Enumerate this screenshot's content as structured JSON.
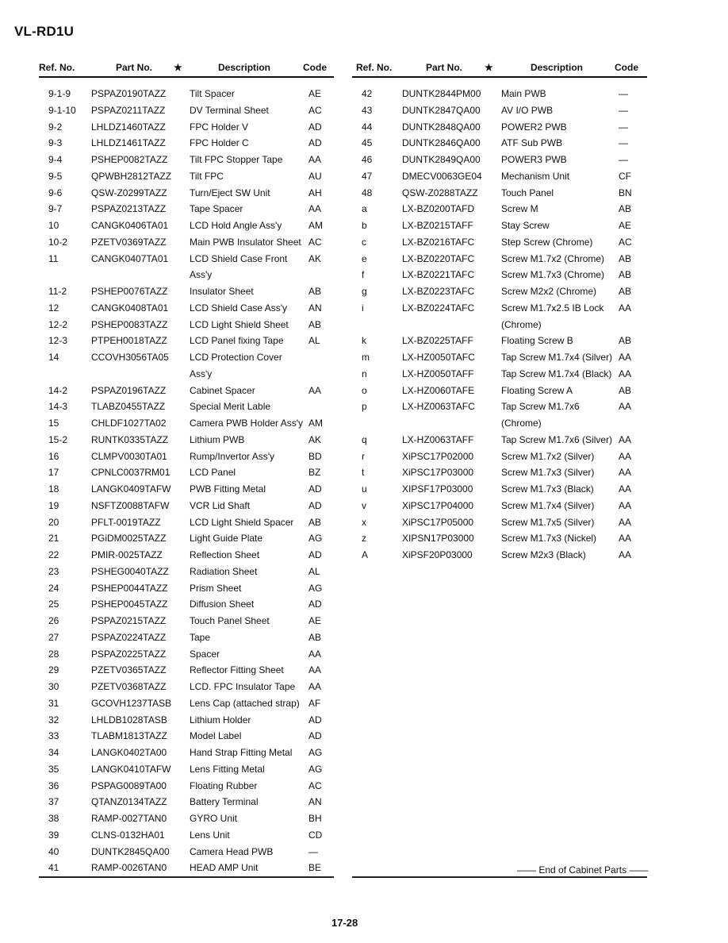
{
  "model": "VL-RD1U",
  "headers": {
    "ref": "Ref. No.",
    "part": "Part No.",
    "star": "★",
    "desc": "Description",
    "code": "Code"
  },
  "left_rows": [
    {
      "ref": "9-1-9",
      "part": "PSPAZ0190TAZZ",
      "desc": "Tilt Spacer",
      "code": "AE"
    },
    {
      "ref": "9-1-10",
      "part": "PSPAZ0211TAZZ",
      "desc": "DV Terminal Sheet",
      "code": "AC"
    },
    {
      "ref": "9-2",
      "part": "LHLDZ1460TAZZ",
      "desc": "FPC Holder V",
      "code": "AD"
    },
    {
      "ref": "9-3",
      "part": "LHLDZ1461TAZZ",
      "desc": "FPC Holder C",
      "code": "AD"
    },
    {
      "ref": "9-4",
      "part": "PSHEP0082TAZZ",
      "desc": "Tilt FPC Stopper Tape",
      "code": "AA"
    },
    {
      "ref": "9-5",
      "part": "QPWBH2812TAZZ",
      "desc": "Tilt FPC",
      "code": "AU"
    },
    {
      "ref": "9-6",
      "part": "QSW-Z0299TAZZ",
      "desc": "Turn/Eject SW Unit",
      "code": "AH"
    },
    {
      "ref": "9-7",
      "part": "PSPAZ0213TAZZ",
      "desc": "Tape Spacer",
      "code": "AA"
    },
    {
      "ref": "10",
      "part": "CANGK0406TA01",
      "desc": "LCD Hold Angle Ass'y",
      "code": "AM"
    },
    {
      "ref": "10-2",
      "part": "PZETV0369TAZZ",
      "desc": "Main PWB Insulator Sheet",
      "code": "AC"
    },
    {
      "ref": "11",
      "part": "CANGK0407TA01",
      "desc": "LCD Shield Case Front",
      "code": "AK"
    },
    {
      "ref": "",
      "part": "",
      "desc": "Ass'y",
      "code": ""
    },
    {
      "ref": "11-2",
      "part": "PSHEP0076TAZZ",
      "desc": "Insulator Sheet",
      "code": "AB"
    },
    {
      "ref": "12",
      "part": "CANGK0408TA01",
      "desc": "LCD Shield Case Ass'y",
      "code": "AN"
    },
    {
      "ref": "12-2",
      "part": "PSHEP0083TAZZ",
      "desc": "LCD Light Shield Sheet",
      "code": "AB"
    },
    {
      "ref": "12-3",
      "part": "PTPEH0018TAZZ",
      "desc": "LCD Panel fixing Tape",
      "code": "AL"
    },
    {
      "ref": "14",
      "part": "CCOVH3056TA05",
      "desc": "LCD Protection Cover",
      "code": ""
    },
    {
      "ref": "",
      "part": "",
      "desc": "Ass'y",
      "code": ""
    },
    {
      "ref": "14-2",
      "part": "PSPAZ0196TAZZ",
      "desc": "Cabinet Spacer",
      "code": "AA"
    },
    {
      "ref": "14-3",
      "part": "TLABZ0455TAZZ",
      "desc": "Special Merit Lable",
      "code": ""
    },
    {
      "ref": "15",
      "part": "CHLDF1027TA02",
      "desc": "Camera PWB Holder Ass'y",
      "code": "AM"
    },
    {
      "ref": "15-2",
      "part": "RUNTK0335TAZZ",
      "desc": "Lithium PWB",
      "code": "AK"
    },
    {
      "ref": "16",
      "part": "CLMPV0030TA01",
      "desc": "Rump/Invertor Ass'y",
      "code": "BD"
    },
    {
      "ref": "17",
      "part": "CPNLC0037RM01",
      "desc": "LCD Panel",
      "code": "BZ"
    },
    {
      "ref": "18",
      "part": "LANGK0409TAFW",
      "desc": "PWB Fitting Metal",
      "code": "AD"
    },
    {
      "ref": "19",
      "part": "NSFTZ0088TAFW",
      "desc": "VCR Lid Shaft",
      "code": "AD"
    },
    {
      "ref": "20",
      "part": "PFLT-0019TAZZ",
      "desc": "LCD Light Shield Spacer",
      "code": "AB"
    },
    {
      "ref": "21",
      "part": "PGiDM0025TAZZ",
      "desc": "Light Guide Plate",
      "code": "AG"
    },
    {
      "ref": "22",
      "part": "PMIR-0025TAZZ",
      "desc": "Reflection Sheet",
      "code": "AD"
    },
    {
      "ref": "23",
      "part": "PSHEG0040TAZZ",
      "desc": "Radiation Sheet",
      "code": "AL"
    },
    {
      "ref": "24",
      "part": "PSHEP0044TAZZ",
      "desc": "Prism Sheet",
      "code": "AG"
    },
    {
      "ref": "25",
      "part": "PSHEP0045TAZZ",
      "desc": "Diffusion Sheet",
      "code": "AD"
    },
    {
      "ref": "26",
      "part": "PSPAZ0215TAZZ",
      "desc": "Touch Panel Sheet",
      "code": "AE"
    },
    {
      "ref": "27",
      "part": "PSPAZ0224TAZZ",
      "desc": "Tape",
      "code": "AB"
    },
    {
      "ref": "28",
      "part": "PSPAZ0225TAZZ",
      "desc": "Spacer",
      "code": "AA"
    },
    {
      "ref": "29",
      "part": "PZETV0365TAZZ",
      "desc": "Reflector Fitting Sheet",
      "code": "AA"
    },
    {
      "ref": "30",
      "part": "PZETV0368TAZZ",
      "desc": "LCD. FPC Insulator Tape",
      "code": "AA"
    },
    {
      "ref": "31",
      "part": "GCOVH1237TASB",
      "desc": "Lens Cap (attached strap)",
      "code": "AF"
    },
    {
      "ref": "32",
      "part": "LHLDB1028TASB",
      "desc": "Lithium Holder",
      "code": "AD"
    },
    {
      "ref": "33",
      "part": "TLABM1813TAZZ",
      "desc": "Model Label",
      "code": "AD"
    },
    {
      "ref": "34",
      "part": "LANGK0402TA00",
      "desc": "Hand Strap Fitting Metal",
      "code": "AG"
    },
    {
      "ref": "35",
      "part": "LANGK0410TAFW",
      "desc": "Lens Fitting Metal",
      "code": "AG"
    },
    {
      "ref": "36",
      "part": "PSPAG0089TA00",
      "desc": "Floating Rubber",
      "code": "AC"
    },
    {
      "ref": "37",
      "part": "QTANZ0134TAZZ",
      "desc": "Battery Terminal",
      "code": "AN"
    },
    {
      "ref": "38",
      "part": "RAMP-0027TAN0",
      "desc": "GYRO Unit",
      "code": "BH"
    },
    {
      "ref": "39",
      "part": "CLNS-0132HA01",
      "desc": "Lens Unit",
      "code": "CD"
    },
    {
      "ref": "40",
      "part": "DUNTK2845QA00",
      "desc": "Camera Head PWB",
      "code": "—"
    },
    {
      "ref": "41",
      "part": "RAMP-0026TAN0",
      "desc": "HEAD AMP Unit",
      "code": "BE"
    }
  ],
  "right_rows": [
    {
      "ref": "42",
      "part": "DUNTK2844PM00",
      "desc": "Main PWB",
      "code": "—"
    },
    {
      "ref": "43",
      "part": "DUNTK2847QA00",
      "desc": "AV I/O PWB",
      "code": "—"
    },
    {
      "ref": "44",
      "part": "DUNTK2848QA00",
      "desc": "POWER2 PWB",
      "code": "—"
    },
    {
      "ref": "45",
      "part": "DUNTK2846QA00",
      "desc": "ATF Sub PWB",
      "code": "—"
    },
    {
      "ref": "46",
      "part": "DUNTK2849QA00",
      "desc": "POWER3 PWB",
      "code": "—"
    },
    {
      "ref": "47",
      "part": "DMECV0063GE04",
      "desc": "Mechanism Unit",
      "code": "CF"
    },
    {
      "ref": "48",
      "part": "QSW-Z0288TAZZ",
      "desc": "Touch Panel",
      "code": "BN"
    },
    {
      "ref": "a",
      "part": "LX-BZ0200TAFD",
      "desc": "Screw M",
      "code": "AB"
    },
    {
      "ref": "b",
      "part": "LX-BZ0215TAFF",
      "desc": "Stay Screw",
      "code": "AE"
    },
    {
      "ref": "c",
      "part": "LX-BZ0216TAFC",
      "desc": "Step Screw (Chrome)",
      "code": "AC"
    },
    {
      "ref": "e",
      "part": "LX-BZ0220TAFC",
      "desc": "Screw M1.7x2 (Chrome)",
      "code": "AB"
    },
    {
      "ref": "f",
      "part": "LX-BZ0221TAFC",
      "desc": "Screw M1.7x3 (Chrome)",
      "code": "AB"
    },
    {
      "ref": "g",
      "part": "LX-BZ0223TAFC",
      "desc": "Screw M2x2 (Chrome)",
      "code": "AB"
    },
    {
      "ref": "i",
      "part": "LX-BZ0224TAFC",
      "desc": "Screw M1.7x2.5 IB Lock",
      "code": "AA"
    },
    {
      "ref": "",
      "part": "",
      "desc": "(Chrome)",
      "code": ""
    },
    {
      "ref": "k",
      "part": "LX-BZ0225TAFF",
      "desc": "Floating Screw B",
      "code": "AB"
    },
    {
      "ref": "m",
      "part": "LX-HZ0050TAFC",
      "desc": "Tap Screw M1.7x4 (Silver)",
      "code": "AA"
    },
    {
      "ref": "n",
      "part": "LX-HZ0050TAFF",
      "desc": "Tap Screw M1.7x4 (Black)",
      "code": "AA"
    },
    {
      "ref": "o",
      "part": "LX-HZ0060TAFE",
      "desc": "Floating Screw A",
      "code": "AB"
    },
    {
      "ref": "p",
      "part": "LX-HZ0063TAFC",
      "desc": "Tap Screw M1.7x6",
      "code": "AA"
    },
    {
      "ref": "",
      "part": "",
      "desc": "(Chrome)",
      "code": ""
    },
    {
      "ref": "q",
      "part": "LX-HZ0063TAFF",
      "desc": "Tap Screw M1.7x6 (Silver)",
      "code": "AA"
    },
    {
      "ref": "r",
      "part": "XiPSC17P02000",
      "desc": "Screw M1.7x2 (Silver)",
      "code": "AA"
    },
    {
      "ref": "t",
      "part": "XiPSC17P03000",
      "desc": "Screw M1.7x3 (Silver)",
      "code": "AA"
    },
    {
      "ref": "u",
      "part": "XIPSF17P03000",
      "desc": "Screw M1.7x3 (Black)",
      "code": "AA"
    },
    {
      "ref": "v",
      "part": "XiPSC17P04000",
      "desc": "Screw M1.7x4 (Silver)",
      "code": "AA"
    },
    {
      "ref": "x",
      "part": "XiPSC17P05000",
      "desc": "Screw M1.7x5 (Silver)",
      "code": "AA"
    },
    {
      "ref": "z",
      "part": "XIPSN17P03000",
      "desc": "Screw M1.7x3 (Nickel)",
      "code": "AA"
    },
    {
      "ref": "A",
      "part": "XiPSF20P03000",
      "desc": "Screw M2x3 (Black)",
      "code": "AA"
    }
  ],
  "end_note": "—— End of Cabinet Parts ——",
  "page_number": "17-28"
}
